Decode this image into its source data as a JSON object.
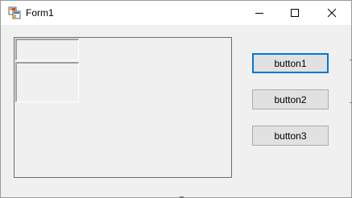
{
  "window": {
    "title": "Form1",
    "icon": "winforms-app-icon",
    "controls": {
      "minimize": "minimize-icon",
      "maximize": "maximize-icon",
      "close": "close-icon"
    }
  },
  "buttons": [
    {
      "label": "button1",
      "focused": true
    },
    {
      "label": "button2",
      "focused": false
    },
    {
      "label": "button3",
      "focused": false
    }
  ],
  "colors": {
    "focus_border": "#0078d7",
    "button_face": "#e1e1e1",
    "form_background": "#f0f0f0",
    "titlebar": "#ffffff"
  }
}
